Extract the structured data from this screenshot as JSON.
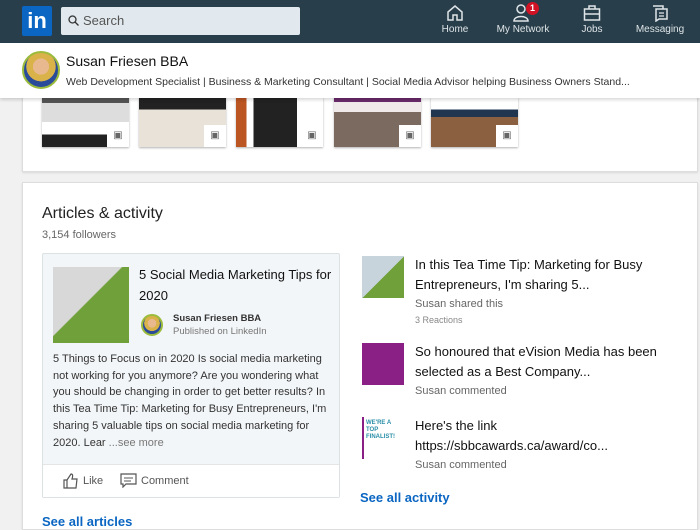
{
  "nav": {
    "logo": "in",
    "search_placeholder": "Search",
    "items": [
      {
        "label": "Home",
        "icon": "home-icon"
      },
      {
        "label": "My Network",
        "icon": "network-icon",
        "badge": "1"
      },
      {
        "label": "Jobs",
        "icon": "briefcase-icon"
      },
      {
        "label": "Messaging",
        "icon": "messaging-icon"
      }
    ]
  },
  "profile": {
    "name": "Susan Friesen BBA",
    "headline": "Web Development Specialist | Business & Marketing Consultant | Social Media Advisor helping Business Owners Stand..."
  },
  "articles": {
    "title": "Articles & activity",
    "followers": "3,154 followers",
    "article": {
      "title": "5 Social Media Marketing Tips for 2020",
      "author": "Susan Friesen BBA",
      "published": "Published on LinkedIn",
      "body": "5 Things to Focus on in 2020 Is social media marketing not working for you anymore? Are you wondering what you should be changing in order to get better results? In this Tea Time Tip: Marketing for Busy Entrepreneurs, I'm sharing 5 valuable tips on social media marketing for 2020. Lear",
      "see_more": "...see more",
      "like": "Like",
      "comment": "Comment"
    },
    "see_all_articles": "See all articles",
    "activity": [
      {
        "title": "In this Tea Time Tip: Marketing for Busy Entrepreneurs, I'm sharing 5...",
        "subtitle": "Susan shared this",
        "reactions": "3 Reactions"
      },
      {
        "title": "So honoured that eVision Media has been selected as a Best Company...",
        "subtitle": "Susan commented"
      },
      {
        "title": "Here's the link https://sbbcawards.ca/award/co...",
        "subtitle": "Susan commented",
        "thumb_text": "WE'RE A TOP FINALIST!"
      }
    ],
    "see_all_activity": "See all activity"
  }
}
